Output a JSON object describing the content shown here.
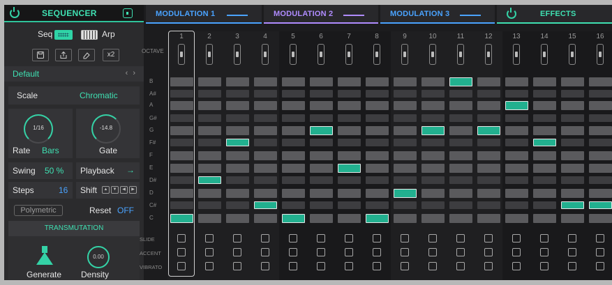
{
  "colors": {
    "accent": "#3fe0b2",
    "mod1": "#4aa3ff",
    "mod2": "#b08cff",
    "mod3": "#4aa3ff",
    "off": "#4aa3ff"
  },
  "sequencer": {
    "title": "SEQUENCER",
    "seq_label": "Seq",
    "arp_label": "Arp",
    "x2_label": "x2",
    "preset": "Default",
    "preset_arrows": "‹ ›",
    "scale_label": "Scale",
    "scale_value": "Chromatic",
    "rate_knob": "1/16",
    "rate_label": "Rate",
    "rate_value": "Bars",
    "gate_knob": "-14.8",
    "gate_label": "Gate",
    "swing_label": "Swing",
    "swing_value": "50 %",
    "playback_label": "Playback",
    "playback_value": "→",
    "steps_label": "Steps",
    "steps_value": "16",
    "shift_label": "Shift",
    "polymetric_label": "Polymetric",
    "reset_label": "Reset",
    "reset_value": "OFF",
    "transmutation_title": "TRANSMUTATION",
    "generate_label": "Generate",
    "density_knob": "0.00",
    "density_label": "Density"
  },
  "tabs": [
    {
      "label": "MODULATION 1"
    },
    {
      "label": "MODULATION 2"
    },
    {
      "label": "MODULATION 3"
    },
    {
      "label": "EFFECTS"
    }
  ],
  "grid": {
    "octave_label": "OCTAVE",
    "notes": [
      "B",
      "A#",
      "A",
      "G#",
      "G",
      "F#",
      "F",
      "E",
      "D#",
      "D",
      "C#",
      "C"
    ],
    "steps": [
      "1",
      "2",
      "3",
      "4",
      "5",
      "6",
      "7",
      "8",
      "9",
      "10",
      "11",
      "12",
      "13",
      "14",
      "15",
      "16"
    ],
    "active_notes": [
      "C",
      "D#",
      "F#",
      "C#",
      "C",
      "G",
      "E",
      "C",
      "D",
      "G",
      "B",
      "G",
      "A",
      "F#",
      "C#",
      "C#"
    ],
    "slide_label": "SLIDE",
    "accent_label": "ACCENT",
    "vibrato_label": "VIBRATO"
  }
}
